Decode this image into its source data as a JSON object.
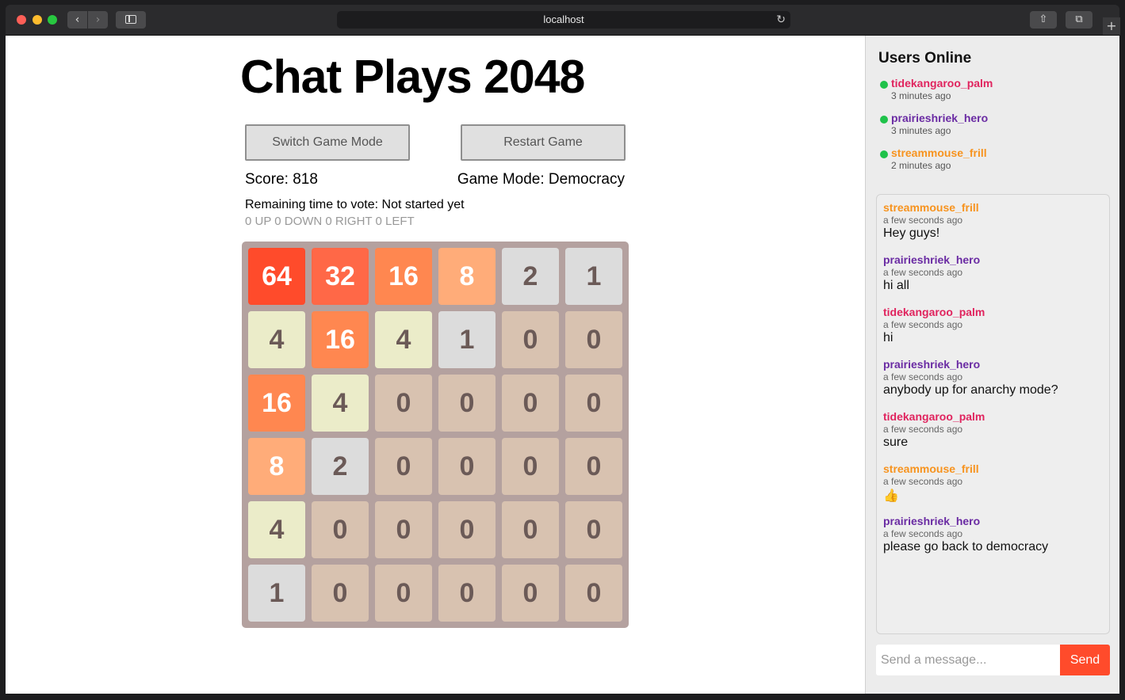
{
  "browser": {
    "url": "localhost",
    "back_icon": "‹",
    "forward_icon": "›",
    "reload_icon": "↻",
    "share_icon": "⇧",
    "tabs_icon": "⧉",
    "new_tab_icon": "+"
  },
  "game": {
    "title": "Chat Plays 2048",
    "switch_mode_label": "Switch Game Mode",
    "restart_label": "Restart Game",
    "score_text": "Score: 818",
    "mode_text": "Game Mode: Democracy",
    "remaining_text": "Remaining time to vote: Not started yet",
    "votes_text": "0 UP 0 DOWN 0 RIGHT 0 LEFT",
    "board": [
      [
        "64",
        "32",
        "16",
        "8",
        "2",
        "1"
      ],
      [
        "4",
        "16",
        "4",
        "1",
        "0",
        "0"
      ],
      [
        "16",
        "4",
        "0",
        "0",
        "0",
        "0"
      ],
      [
        "8",
        "2",
        "0",
        "0",
        "0",
        "0"
      ],
      [
        "4",
        "0",
        "0",
        "0",
        "0",
        "0"
      ],
      [
        "1",
        "0",
        "0",
        "0",
        "0",
        "0"
      ]
    ],
    "tile_colors": {
      "0": "#d8c2b0",
      "1": "#dcdcdc",
      "2": "#dcdcdc",
      "4": "#ebecc9",
      "8": "#ffac79",
      "16": "#ff8750",
      "32": "#ff6847",
      "64": "#ff4b2b"
    }
  },
  "chat": {
    "users_header": "Users Online",
    "users": [
      {
        "name": "tidekangaroo_palm",
        "time": "3 minutes ago",
        "color": "#e0245e"
      },
      {
        "name": "prairieshriek_hero",
        "time": "3 minutes ago",
        "color": "#6a2ba3"
      },
      {
        "name": "streammouse_frill",
        "time": "2 minutes ago",
        "color": "#f7931e"
      }
    ],
    "messages": [
      {
        "name": "streammouse_frill",
        "time": "a few seconds ago",
        "text": "Hey guys!",
        "color": "#f7931e"
      },
      {
        "name": "prairieshriek_hero",
        "time": "a few seconds ago",
        "text": "hi all",
        "color": "#6a2ba3"
      },
      {
        "name": "tidekangaroo_palm",
        "time": "a few seconds ago",
        "text": "hi",
        "color": "#e0245e"
      },
      {
        "name": "prairieshriek_hero",
        "time": "a few seconds ago",
        "text": "anybody up for anarchy mode?",
        "color": "#6a2ba3"
      },
      {
        "name": "tidekangaroo_palm",
        "time": "a few seconds ago",
        "text": "sure",
        "color": "#e0245e"
      },
      {
        "name": "streammouse_frill",
        "time": "a few seconds ago",
        "text": "👍",
        "color": "#f7931e"
      },
      {
        "name": "prairieshriek_hero",
        "time": "a few seconds ago",
        "text": "please go back to democracy",
        "color": "#6a2ba3"
      }
    ],
    "input_placeholder": "Send a message...",
    "send_label": "Send"
  }
}
